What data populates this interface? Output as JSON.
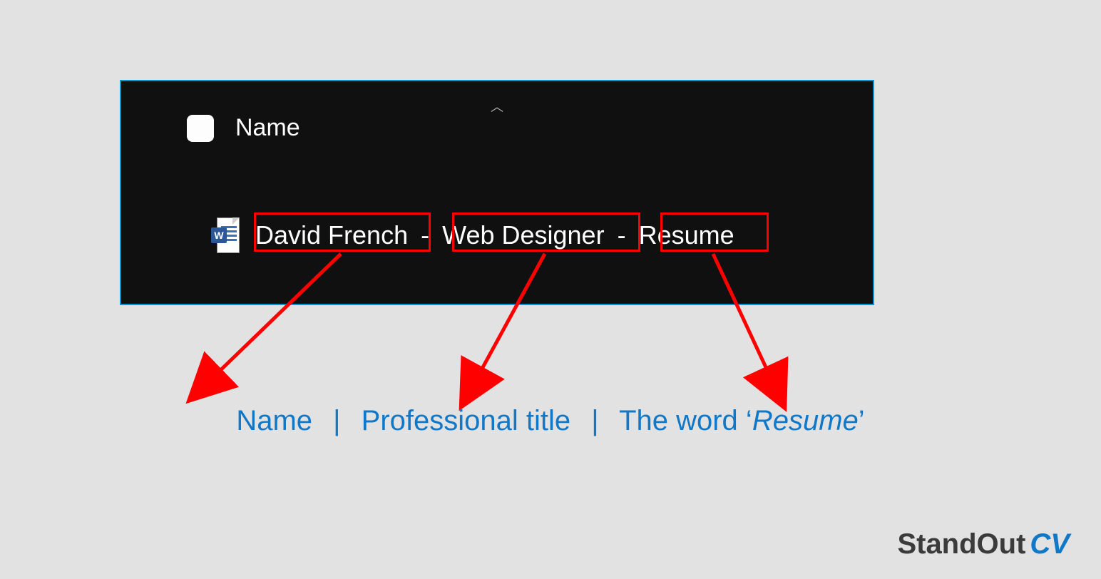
{
  "explorer": {
    "column_header": "Name",
    "file": {
      "icon": "word-icon",
      "parts": {
        "name": "David French",
        "title": "Web Designer",
        "doc_label": "Resume"
      },
      "separator": "-"
    }
  },
  "annotations": {
    "name_label": "Name",
    "title_label": "Professional title",
    "doc_label_prefix": "The word ‘",
    "doc_label_italic": "Resume",
    "doc_label_suffix": "’",
    "separator": "|"
  },
  "brand": {
    "part1": "StandOut",
    "part2": "CV"
  }
}
